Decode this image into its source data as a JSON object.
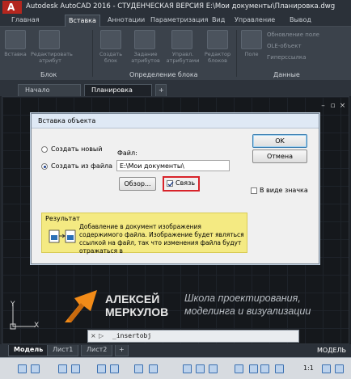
{
  "window": {
    "logo_letter": "A",
    "title": "Autodesk AutoCAD 2016 - СТУДЕНЧЕСКАЯ ВЕРСИЯ    E:\\Мои документы\\Планировка.dwg"
  },
  "ribbon": {
    "tabs": [
      "Главная",
      "Вставка",
      "Аннотации",
      "Параметризация",
      "Вид",
      "Управление",
      "Вывод"
    ],
    "active_tab": "Вставка",
    "panels": {
      "block": {
        "title": "Блок",
        "buttons": [
          "Вставка",
          "Редактировать атрибут"
        ]
      },
      "block_definition": {
        "title": "Определение блока",
        "buttons": [
          "Создать блок",
          "Задание атрибутов",
          "Управл. атрибутами",
          "Редактор блоков"
        ]
      },
      "data": {
        "title": "Данные",
        "button": "Поле",
        "items": [
          "Обновление поле",
          "OLE-объект",
          "Гиперссылка"
        ]
      }
    }
  },
  "file_tabs": [
    "Начало",
    "Планировка"
  ],
  "active_file_tab": "Планировка",
  "dialog": {
    "title": "Вставка объекта",
    "radio_new": "Создать новый",
    "radio_from_file": "Создать из файла",
    "file_label": "Файл:",
    "file_path": "E:\\Мои документы\\",
    "browse_button": "Обзор...",
    "link_checkbox": "Связь",
    "link_checked": true,
    "as_icon_checkbox": "В виде значка",
    "as_icon_checked": false,
    "ok_button": "OK",
    "cancel_button": "Отмена",
    "result_label": "Результат",
    "result_text": "Добавление в документ изображения содержимого файла.  Изображение будет являться ссылкой на файл, так что изменения файла будут отражаться в"
  },
  "watermark": {
    "name_line1": "АЛЕКСЕЙ",
    "name_line2": "МЕРКУЛОВ",
    "tagline1": "Школа проектирования,",
    "tagline2": "моделинга и визуализации",
    "brand_color": "#f28b18"
  },
  "ucs": {
    "y": "Y",
    "x": "X"
  },
  "command_line": {
    "close": "×",
    "prompt_icon": "▷",
    "text": "_insertobj"
  },
  "layout_tabs": [
    "Модель",
    "Лист1",
    "Лист2"
  ],
  "active_layout_tab": "Модель",
  "status": {
    "space": "МОДЕЛЬ",
    "zoom": "1:1"
  },
  "colors": {
    "accent_red": "#d8232a",
    "ribbon_bg": "#3b424b",
    "result_yellow": "#f4ea82"
  }
}
